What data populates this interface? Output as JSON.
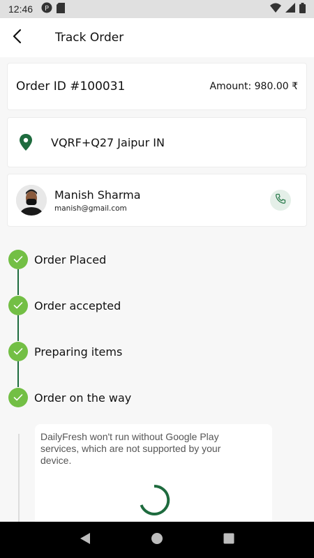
{
  "status_bar": {
    "time": "12:46",
    "icons": [
      "notification-p-icon",
      "sd-card-icon",
      "wifi-icon",
      "signal-icon",
      "battery-icon"
    ]
  },
  "header": {
    "title": "Track Order",
    "back_icon": "arrow-back-icon"
  },
  "order": {
    "id_label": "Order ID #100031",
    "amount_label": "Amount: 980.00 ₹"
  },
  "address": {
    "icon": "location-pin-icon",
    "text": "VQRF+Q27 Jaipur IN"
  },
  "customer": {
    "name": "Manish Sharma",
    "email": "manish@gmail.com",
    "call_icon": "phone-icon"
  },
  "timeline": {
    "steps": [
      {
        "label": "Order Placed"
      },
      {
        "label": "Order accepted"
      },
      {
        "label": "Preparing items"
      },
      {
        "label": "Order on the way"
      }
    ]
  },
  "dialog": {
    "message": "DailyFresh won't run without Google Play services, which are not supported by your device."
  },
  "colors": {
    "accent_green": "#1e6b3e",
    "check_green": "#73bf45",
    "call_bg": "#e4efe8"
  },
  "nav": {
    "icons": [
      "back-triangle-icon",
      "home-circle-icon",
      "recents-square-icon"
    ]
  }
}
